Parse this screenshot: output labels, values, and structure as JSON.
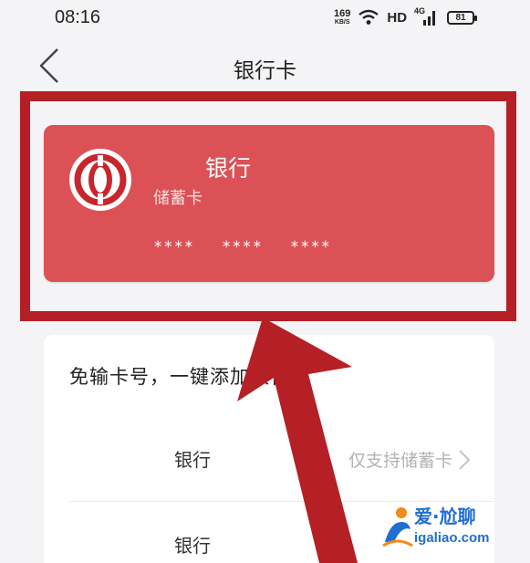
{
  "status_bar": {
    "time": "08:16",
    "net_speed": "169",
    "net_speed_unit": "KB/S",
    "network": "HD",
    "signal_label": "4G",
    "battery": "81"
  },
  "header": {
    "title": "银行卡"
  },
  "card": {
    "bank_name": "银行",
    "card_type": "储蓄卡",
    "number_groups": [
      "****",
      "****",
      "****"
    ],
    "color": "#dc5156"
  },
  "add_panel": {
    "title": "免输卡号，一键添加银行卡",
    "rows": [
      {
        "label": "银行",
        "support": "仅支持储蓄卡"
      },
      {
        "label": "银行"
      }
    ]
  },
  "annotation": {
    "frame_color": "#b51f26"
  },
  "watermark": {
    "title": "爱·尬聊",
    "url": "igaliao.com"
  }
}
